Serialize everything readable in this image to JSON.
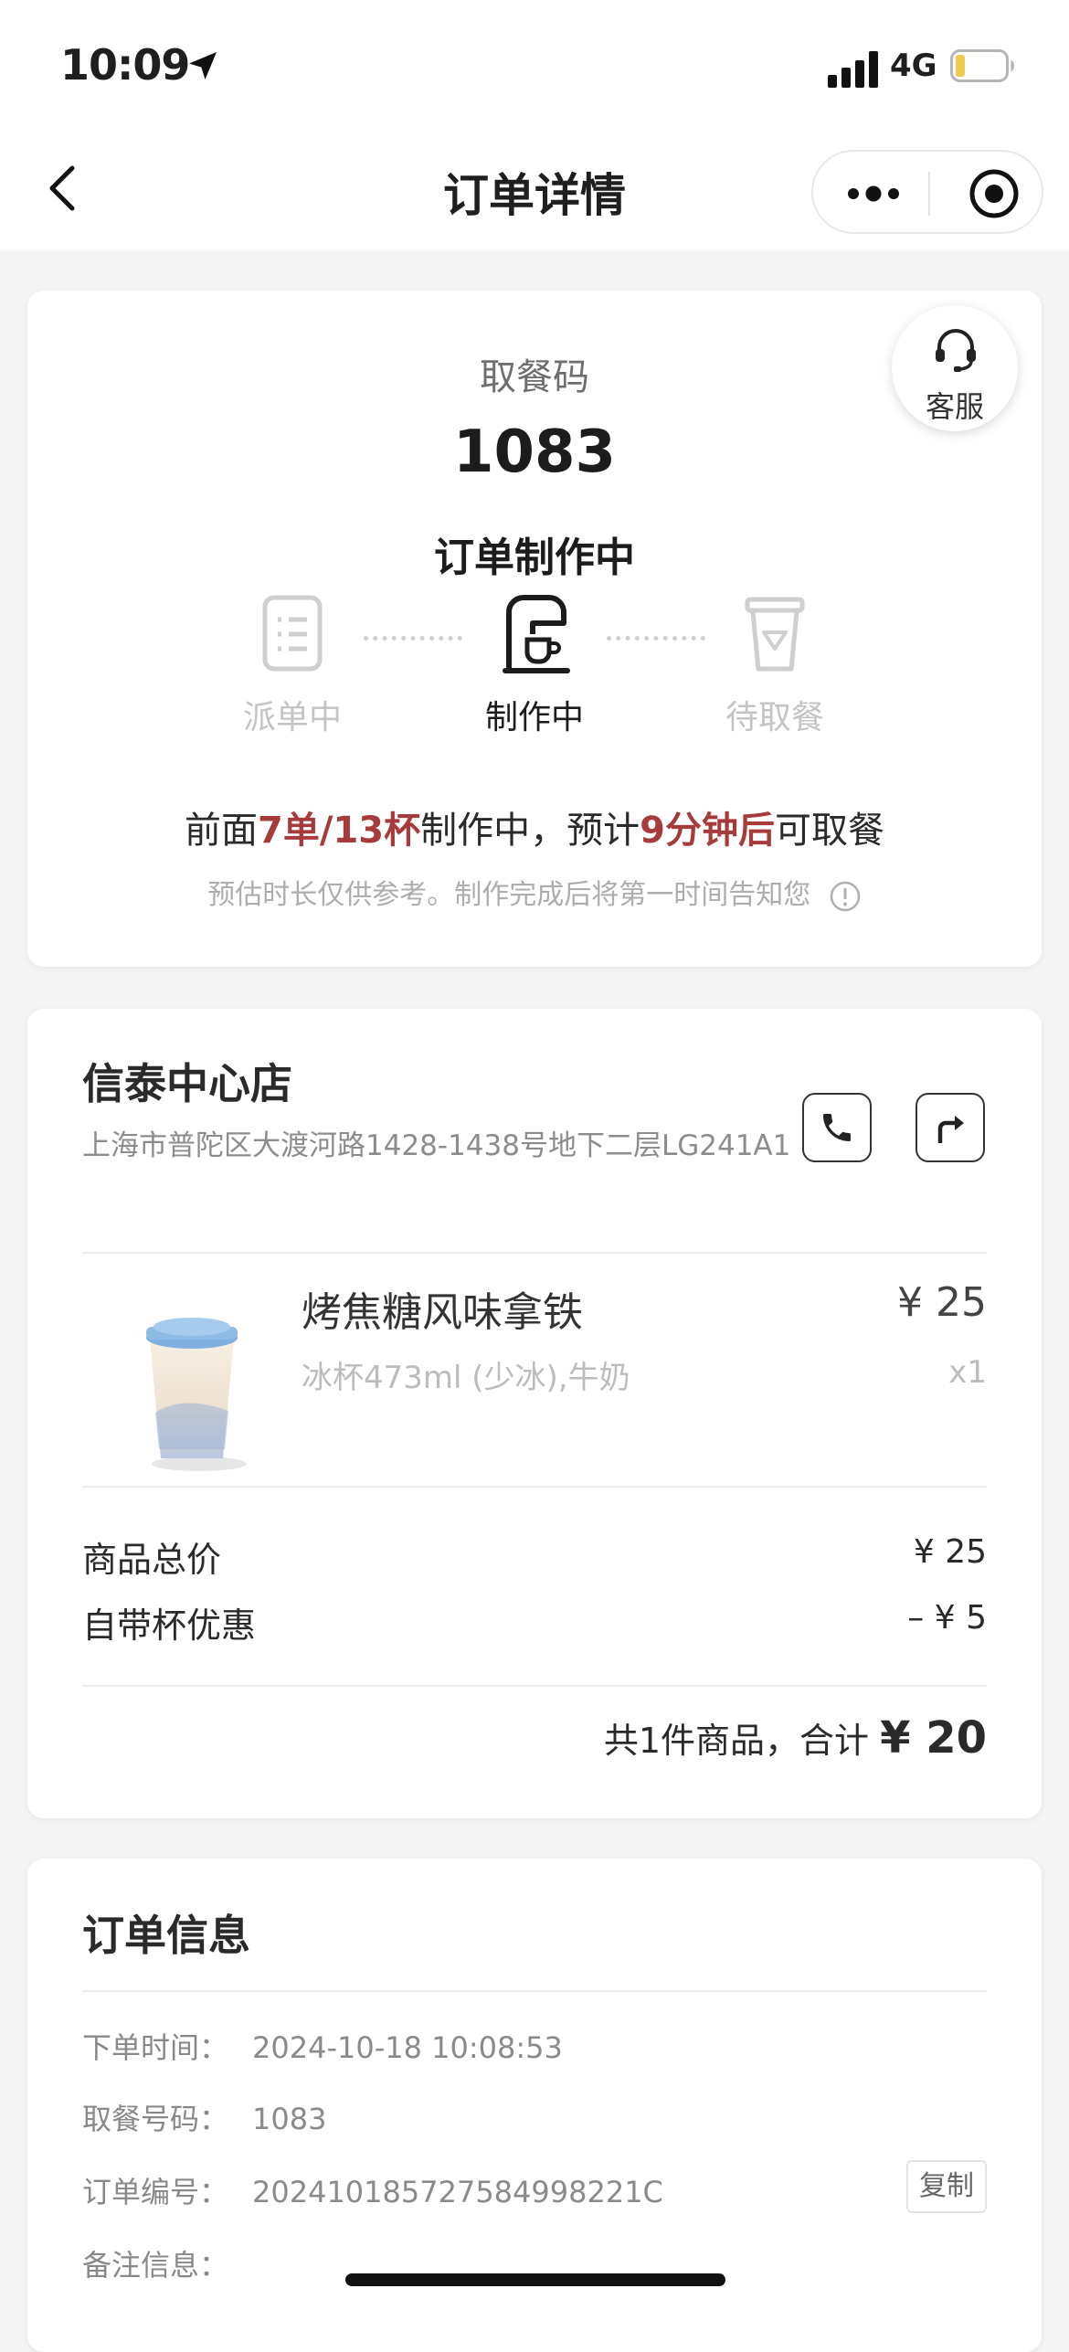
{
  "status_bar": {
    "time": "10:09",
    "network": "4G"
  },
  "nav": {
    "title": "订单详情"
  },
  "pickup": {
    "label": "取餐码",
    "code": "1083",
    "status": "订单制作中",
    "service_label": "客服",
    "steps": [
      {
        "label": "派单中",
        "state": "inactive"
      },
      {
        "label": "制作中",
        "state": "active"
      },
      {
        "label": "待取餐",
        "state": "inactive"
      }
    ],
    "eta_prefix": "前面",
    "eta_queue": "7单/13杯",
    "eta_middle": "制作中，预计",
    "eta_time": "9分钟后",
    "eta_suffix": "可取餐",
    "note": "预估时长仅供参考。制作完成后将第一时间告知您"
  },
  "store": {
    "name": "信泰中心店",
    "address": "上海市普陀区大渡河路1428-1438号地下二层LG241A1"
  },
  "product": {
    "name": "烤焦糖风味拿铁",
    "spec": "冰杯473ml (少冰),牛奶",
    "price": "¥ 25",
    "qty": "x1"
  },
  "summary": {
    "subtotal_label": "商品总价",
    "subtotal_value": "¥ 25",
    "discount_label": "自带杯优惠",
    "discount_value": "–  ¥ 5",
    "total_prefix": "共1件商品，合计",
    "total_amount": "¥ 20"
  },
  "order_info": {
    "title": "订单信息",
    "rows": [
      {
        "key": "下单时间：",
        "value": "2024-10-18 10:08:53"
      },
      {
        "key": "取餐号码：",
        "value": "1083"
      },
      {
        "key": "订单编号：",
        "value": "20241018572758499822​1C"
      },
      {
        "key": "备注信息：",
        "value": ""
      }
    ],
    "copy_label": "复制"
  },
  "colors": {
    "highlight": "#a73b3b",
    "muted": "#c4c4c4"
  }
}
